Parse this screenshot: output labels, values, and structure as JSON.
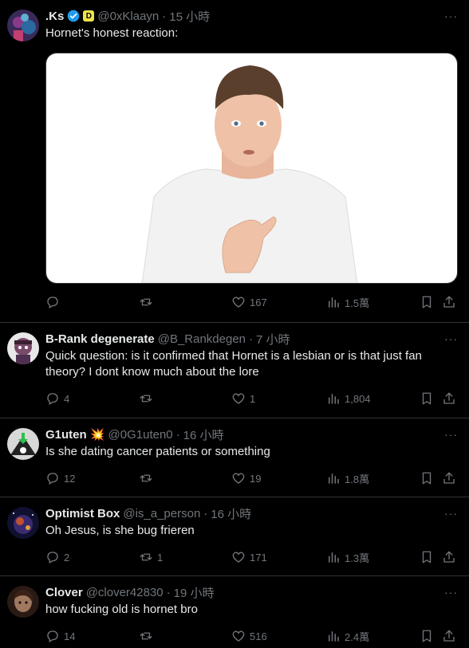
{
  "tweets": [
    {
      "name": ".Ks",
      "handle": "@0xKlaayn",
      "time": "15 小時",
      "text": "Hornet's honest reaction:",
      "reply": "",
      "retweet": "",
      "like": "167",
      "views": "1.5萬",
      "verified": true,
      "badge": "D"
    },
    {
      "name": "B-Rank degenerate",
      "handle": "@B_Rankdegen",
      "time": "7 小時",
      "text": "Quick question: is it confirmed that Hornet is a lesbian or is that just fan theory? I dont know much about the lore",
      "reply": "4",
      "retweet": "",
      "like": "1",
      "views": "1,804"
    },
    {
      "name": "G1uten 💥",
      "handle": "@0G1uten0",
      "time": "16 小時",
      "text": "Is she dating cancer patients or something",
      "reply": "12",
      "retweet": "",
      "like": "19",
      "views": "1.8萬"
    },
    {
      "name": "Optimist Box",
      "handle": "@is_a_person",
      "time": "16 小時",
      "text": "Oh Jesus, is she bug frieren",
      "reply": "2",
      "retweet": "1",
      "like": "171",
      "views": "1.3萬"
    },
    {
      "name": "Clover",
      "handle": "@clover42830",
      "time": "19 小時",
      "text": "how fucking old is hornet bro",
      "reply": "14",
      "retweet": "",
      "like": "516",
      "views": "2.4萬"
    }
  ],
  "colors": {
    "background": "#000000",
    "text": "#e7e9ea",
    "muted": "#71767b",
    "divider": "#2f3336",
    "verified": "#1d9bf0"
  },
  "icons": [
    "reply-icon",
    "retweet-icon",
    "heart-icon",
    "views-icon",
    "bookmark-icon",
    "share-icon",
    "more-icon",
    "verified-icon"
  ]
}
